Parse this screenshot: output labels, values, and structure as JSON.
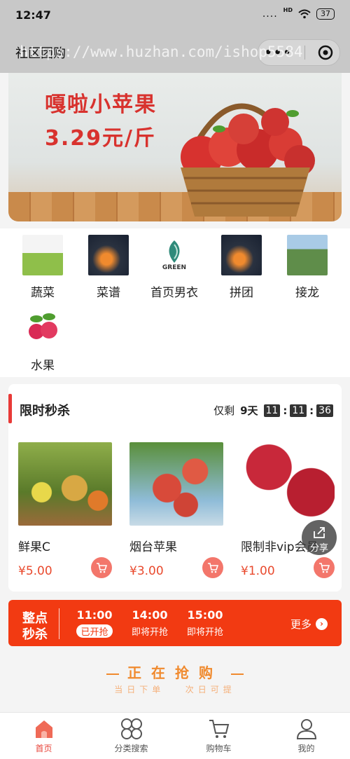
{
  "status_bar": {
    "time": "12:47",
    "signal": "....",
    "network": "HD",
    "battery": "37"
  },
  "navbar": {
    "title": "社区团购",
    "more_label": "•••"
  },
  "watermark": "https://www.huzhan.com/ishop5584",
  "banner": {
    "headline": "嘎啦小苹果",
    "price": "3.29元/斤"
  },
  "categories": [
    {
      "label": "蔬菜",
      "icon": "vegetable-thumb"
    },
    {
      "label": "菜谱",
      "icon": "recipe-thumb"
    },
    {
      "label": "首页男衣",
      "icon": "green-logo-thumb",
      "logo_text": "GREEN"
    },
    {
      "label": "拼团",
      "icon": "group-buy-thumb"
    },
    {
      "label": "接龙",
      "icon": "relay-thumb"
    },
    {
      "label": "水果",
      "icon": "fruit-thumb"
    }
  ],
  "seckill": {
    "title": "限时秒杀",
    "remaining_label": "仅剩",
    "days": "9天",
    "hours": "11",
    "minutes": "11",
    "seconds": "36",
    "products": [
      {
        "name": "鲜果C",
        "price": "¥5.00"
      },
      {
        "name": "烟台苹果",
        "price": "¥3.00"
      },
      {
        "name": "限制非vip会员",
        "price": "¥1.00"
      }
    ]
  },
  "share_label": "分享",
  "hourly": {
    "title_line1": "整点",
    "title_line2": "秒杀",
    "slots": [
      {
        "time": "11:00",
        "status": "已开抢"
      },
      {
        "time": "14:00",
        "status": "即将开抢"
      },
      {
        "time": "15:00",
        "status": "即将开抢"
      }
    ],
    "more_label": "更多"
  },
  "grabbing": {
    "title": "正在抢购",
    "subtitle_left": "当日下单",
    "subtitle_right": "次日可提"
  },
  "tabs": [
    {
      "label": "首页",
      "icon": "home-icon"
    },
    {
      "label": "分类搜索",
      "icon": "category-icon"
    },
    {
      "label": "购物车",
      "icon": "cart-icon"
    },
    {
      "label": "我的",
      "icon": "user-icon"
    }
  ],
  "colors": {
    "accent": "#e8443a",
    "seckill_bar": "#f23a12",
    "price": "#e94a2e"
  }
}
